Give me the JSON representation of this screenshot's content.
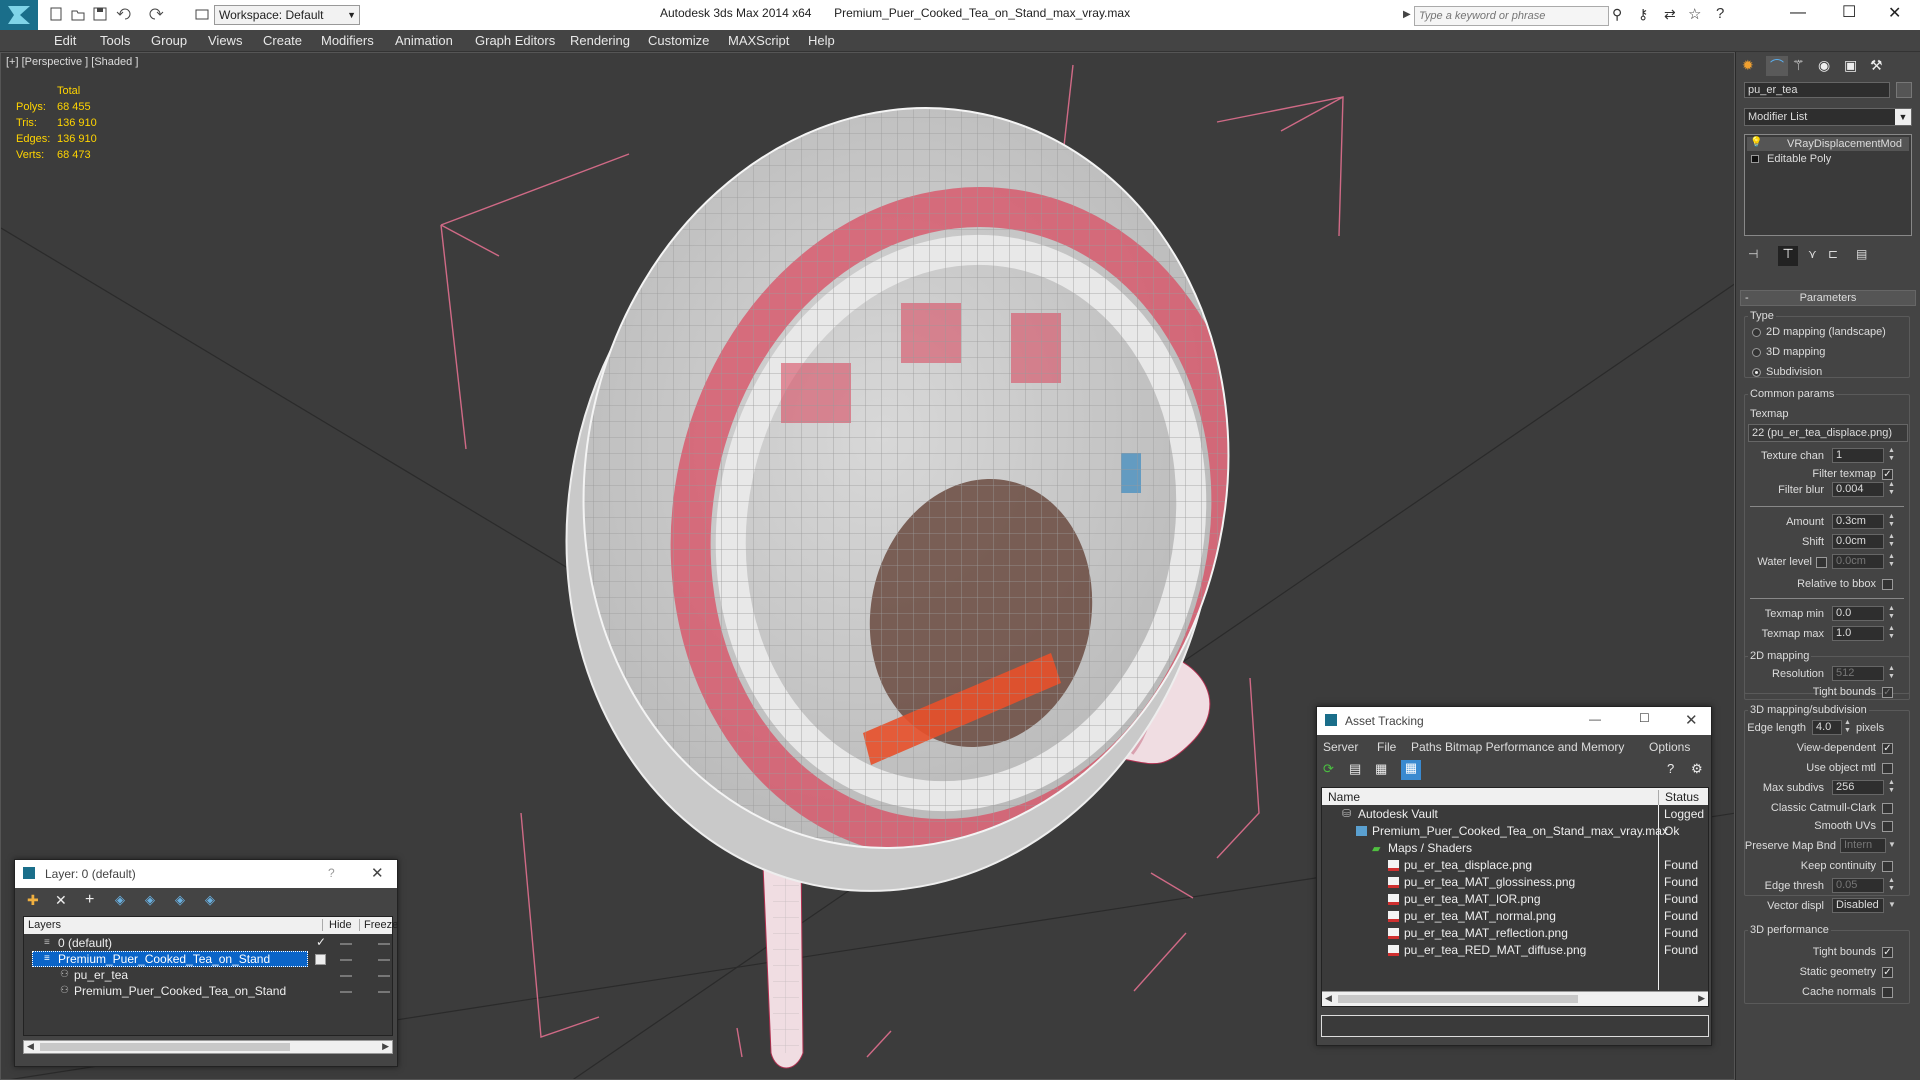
{
  "app": {
    "title_prefix": "Autodesk 3ds Max  2014 x64",
    "file_name": "Premium_Puer_Cooked_Tea_on_Stand_max_vray.max",
    "workspace_label": "Workspace: Default",
    "search_placeholder": "Type a keyword or phrase"
  },
  "menu": [
    "Edit",
    "Tools",
    "Group",
    "Views",
    "Create",
    "Modifiers",
    "Animation",
    "Graph Editors",
    "Rendering",
    "Customize",
    "MAXScript",
    "Help"
  ],
  "viewport": {
    "label": "[+] [Perspective ] [Shaded ]",
    "stats_header": "Total",
    "stats": [
      {
        "label": "Polys:",
        "value": "68 455"
      },
      {
        "label": "Tris:",
        "value": "136 910"
      },
      {
        "label": "Edges:",
        "value": "136 910"
      },
      {
        "label": "Verts:",
        "value": "68 473"
      }
    ]
  },
  "command_panel": {
    "object_name": "pu_er_tea",
    "modifier_list_label": "Modifier List",
    "stack": [
      "VRayDisplacementMod",
      "Editable Poly"
    ],
    "rollout_title": "Parameters",
    "type_label": "Type",
    "type_options": [
      "2D mapping (landscape)",
      "3D mapping",
      "Subdivision"
    ],
    "type_selected": 2,
    "common_label": "Common params",
    "texmap_label": "Texmap",
    "texmap_value": "22 (pu_er_tea_displace.png)",
    "params_a": [
      {
        "label": "Texture chan",
        "value": "1"
      },
      {
        "label": "Filter texmap",
        "check": true
      },
      {
        "label": "Filter blur",
        "value": "0.004"
      },
      {
        "label": "Amount",
        "value": "0.3cm"
      },
      {
        "label": "Shift",
        "value": "0.0cm"
      },
      {
        "label": "Water level",
        "value": "0.0cm",
        "check": false
      },
      {
        "label": "Relative to bbox",
        "check": false
      },
      {
        "label": "Texmap min",
        "value": "0.0"
      },
      {
        "label": "Texmap max",
        "value": "1.0"
      }
    ],
    "mapping2d_label": "2D mapping",
    "resolution_label": "Resolution",
    "resolution_value": "512",
    "tight_bounds_label": "Tight bounds",
    "mapping3d_label": "3D mapping/subdivision",
    "edge_length_label": "Edge length",
    "edge_length_value": "4.0",
    "pixels_label": "pixels",
    "params_b": [
      {
        "label": "View-dependent",
        "check": true
      },
      {
        "label": "Use object mtl",
        "check": false
      },
      {
        "label": "Max subdivs",
        "value": "256"
      },
      {
        "label": "Classic Catmull-Clark",
        "check": false
      },
      {
        "label": "Smooth UVs",
        "check": false
      },
      {
        "label": "Preserve Map Bnd",
        "value": "Intern"
      },
      {
        "label": "Keep continuity",
        "check": false
      },
      {
        "label": "Edge thresh",
        "value": "0.05"
      },
      {
        "label": "Vector displ",
        "value": "Disabled"
      }
    ],
    "perf_label": "3D performance",
    "perf": [
      {
        "label": "Tight bounds",
        "check": true
      },
      {
        "label": "Static geometry",
        "check": true
      },
      {
        "label": "Cache normals",
        "check": false
      }
    ]
  },
  "layer_window": {
    "title": "Layer: 0 (default)",
    "help": "?",
    "col_layers": "Layers",
    "col_hide": "Hide",
    "col_freeze": "Freeze",
    "rows": [
      {
        "name": "0 (default)",
        "indent": 1,
        "selected": false
      },
      {
        "name": "Premium_Puer_Cooked_Tea_on_Stand",
        "indent": 1,
        "selected": true
      },
      {
        "name": "pu_er_tea",
        "indent": 2,
        "selected": false
      },
      {
        "name": "Premium_Puer_Cooked_Tea_on_Stand",
        "indent": 2,
        "selected": false
      }
    ]
  },
  "asset_window": {
    "title": "Asset Tracking",
    "menu": [
      "Server",
      "File",
      "Paths",
      "Bitmap Performance and Memory",
      "Options"
    ],
    "col_name": "Name",
    "col_status": "Status",
    "rows": [
      {
        "name": "Autodesk Vault",
        "status": "Logged",
        "indent": 0
      },
      {
        "name": "Premium_Puer_Cooked_Tea_on_Stand_max_vray.max",
        "status": "Ok",
        "indent": 1
      },
      {
        "name": "Maps / Shaders",
        "status": "",
        "indent": 2
      },
      {
        "name": "pu_er_tea_displace.png",
        "status": "Found",
        "indent": 3
      },
      {
        "name": "pu_er_tea_MAT_glossiness.png",
        "status": "Found",
        "indent": 3
      },
      {
        "name": "pu_er_tea_MAT_IOR.png",
        "status": "Found",
        "indent": 3
      },
      {
        "name": "pu_er_tea_MAT_normal.png",
        "status": "Found",
        "indent": 3
      },
      {
        "name": "pu_er_tea_MAT_reflection.png",
        "status": "Found",
        "indent": 3
      },
      {
        "name": "pu_er_tea_RED_MAT_diffuse.png",
        "status": "Found",
        "indent": 3
      }
    ]
  }
}
